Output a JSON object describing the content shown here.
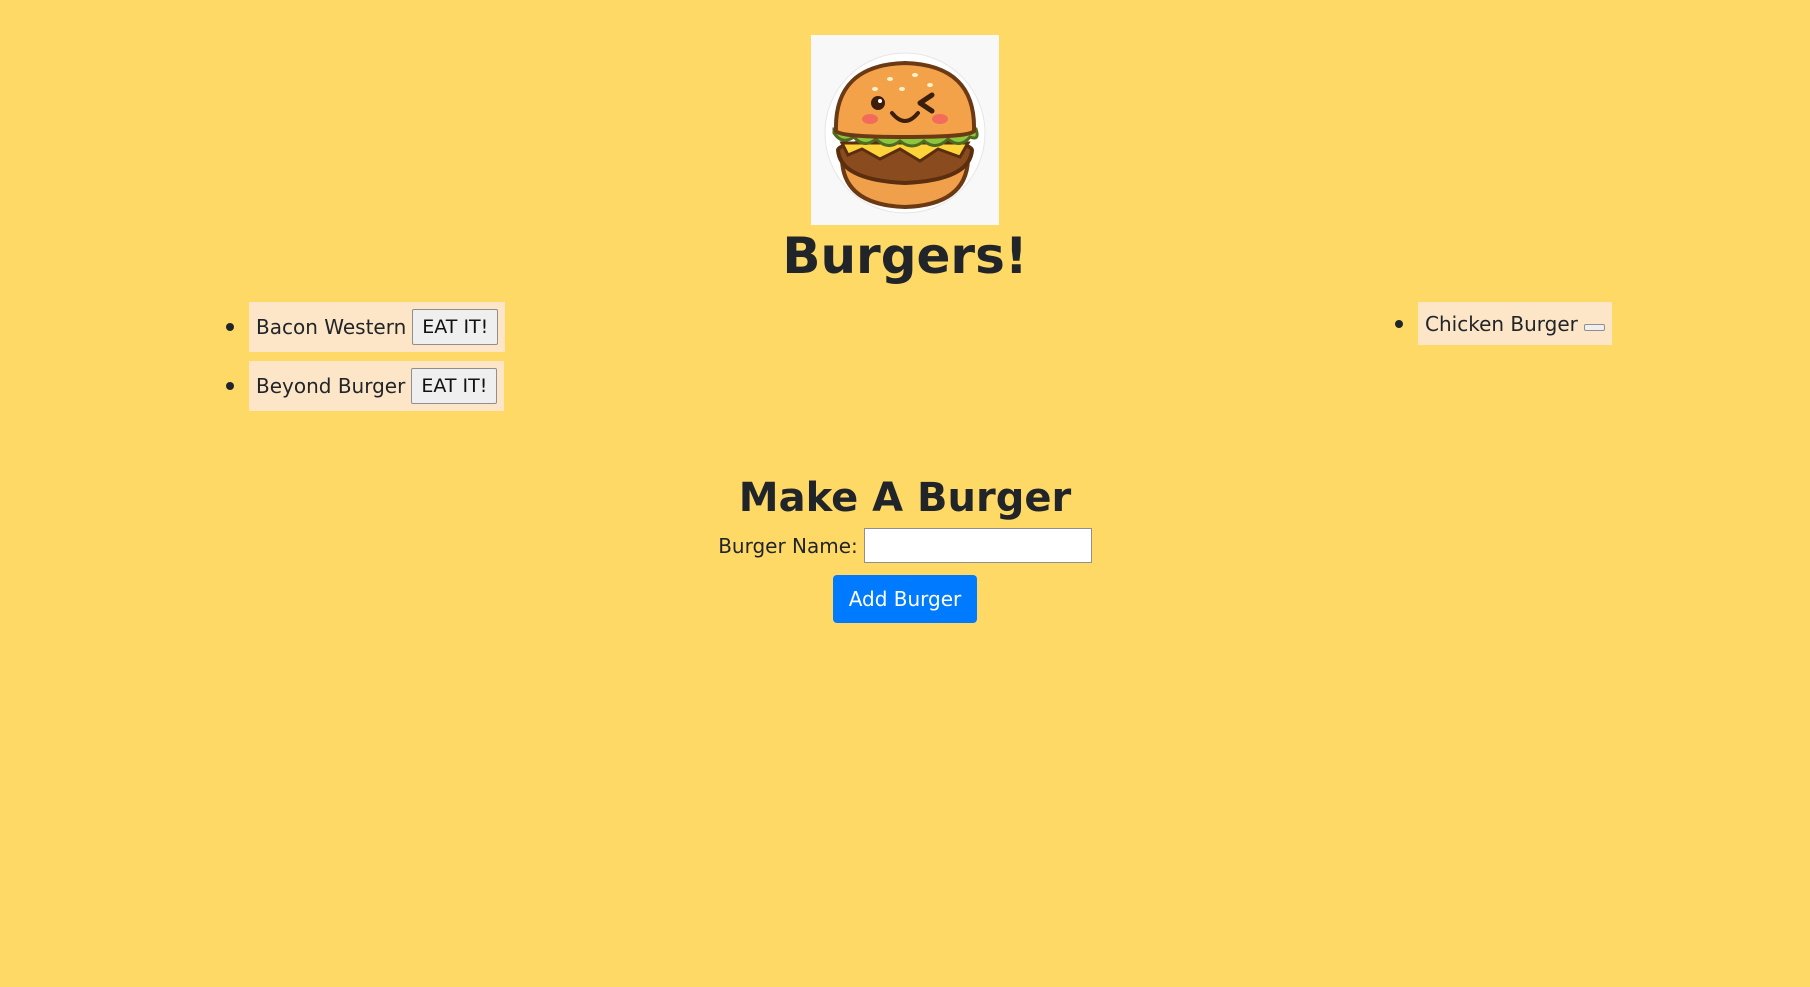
{
  "logo": {
    "icon": "burger-mascot-icon",
    "background": "#f8f8f8"
  },
  "title": "Burgers!",
  "uneaten_burgers": [
    {
      "name": "Bacon Western",
      "button_label": "EAT IT!"
    },
    {
      "name": "Beyond Burger",
      "button_label": "EAT IT!"
    }
  ],
  "eaten_burgers": [
    {
      "name": "Chicken Burger",
      "button_label": ""
    }
  ],
  "form": {
    "title": "Make A Burger",
    "field_label": "Burger Name:",
    "input_value": "",
    "input_placeholder": "",
    "submit_label": "Add Burger"
  },
  "colors": {
    "page_background": "#ffd966",
    "item_background": "#fde6c7",
    "primary_button": "#007bff"
  }
}
